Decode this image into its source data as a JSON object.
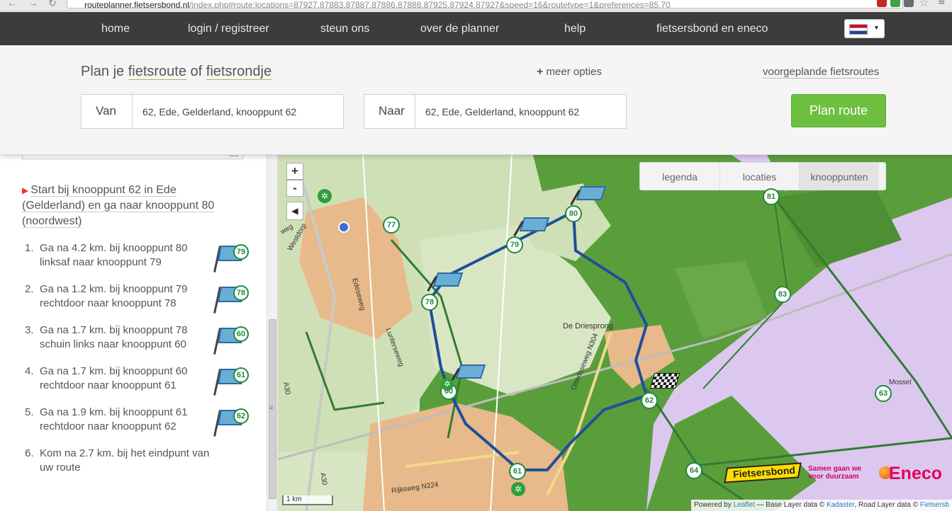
{
  "browser": {
    "url_host": "routeplanner.fietsersbond.nl",
    "url_path": "/index.php#route:locations=87927,87883,87887,87886,87888,87925,87924,87927&speed=16&routetype=1&preferences=85,70"
  },
  "nav": {
    "items": [
      {
        "label": "home"
      },
      {
        "label": "login / registreer"
      },
      {
        "label": "steun ons"
      },
      {
        "label": "over de planner"
      },
      {
        "label": "help"
      },
      {
        "label": "fietsersbond en eneco"
      }
    ],
    "language": "nl"
  },
  "planner": {
    "title_prefix": "Plan je",
    "title_route": "fietsroute",
    "title_of": "of",
    "title_loop": "fietsrondje",
    "more_options": "meer opties",
    "preplanned_link": "voorgeplande fietsroutes",
    "from_label": "Van",
    "from_value": "62, Ede, Gelderland, knooppunt 62",
    "to_label": "Naar",
    "to_value": "62, Ede, Gelderland, knooppunt 62",
    "plan_button": "Plan route"
  },
  "route": {
    "start_text": "Start bij knooppunt 62 in Ede (Gelderland) en ga naar knooppunt 80 (noordwest)",
    "steps": [
      {
        "num": "1.",
        "line1": "Ga na 4.2 km. bij knooppunt 80",
        "line2": "linksaf naar knooppunt 79",
        "node": "79"
      },
      {
        "num": "2.",
        "line1": "Ga na 1.2 km. bij knooppunt 79",
        "line2": "rechtdoor naar knooppunt 78",
        "node": "78"
      },
      {
        "num": "3.",
        "line1": "Ga na 1.7 km. bij knooppunt 78",
        "line2": "schuin links naar knooppunt 60",
        "node": "60"
      },
      {
        "num": "4.",
        "line1": "Ga na 1.7 km. bij knooppunt 60",
        "line2": "rechtdoor naar knooppunt 61",
        "node": "61"
      },
      {
        "num": "5.",
        "line1": "Ga na 1.9 km. bij knooppunt 61",
        "line2": "rechtdoor naar knooppunt 62",
        "node": "62"
      },
      {
        "num": "6.",
        "line1": "Kom na 2.7 km. bij het eindpunt van",
        "line2": "uw route",
        "node": ""
      }
    ]
  },
  "map": {
    "zoom_in": "+",
    "zoom_out": "-",
    "collapse": "◀",
    "tabs": [
      {
        "label": "legenda",
        "active": false
      },
      {
        "label": "locaties",
        "active": false
      },
      {
        "label": "knooppunten",
        "active": true
      }
    ],
    "nodes": [
      "80",
      "79",
      "78",
      "60",
      "61",
      "62",
      "77",
      "81",
      "83",
      "63",
      "64"
    ],
    "labels": {
      "place1": "De Driesprong",
      "place2": "Mossel",
      "road1": "Otterloseweg N304",
      "road2": "Rijksweg N224",
      "road3": "Edeseweg",
      "road4": "Lunterseweg",
      "road5": "Westdorp",
      "road6": "A30",
      "road7": "A30",
      "road8": "weg"
    },
    "scale": "1 km",
    "attribution_powered": "Powered by",
    "attribution_leaflet": "Leaflet",
    "attribution_base": "— Base Layer data ©",
    "attribution_kadaster": "Kadaster",
    "attribution_road": ", Road Layer data ©",
    "attribution_fb": "Fietsersb",
    "fb_logo": "Fietsersbond",
    "eneco_slogan": "Samen gaan we voor duurzaam",
    "eneco_name": "Eneco",
    "colors": {
      "forest": "#5a9e3c",
      "heath": "#dcc8ee",
      "urban": "#e8b98a",
      "route": "#1f4e9a",
      "node": "#1e8a3e"
    }
  }
}
